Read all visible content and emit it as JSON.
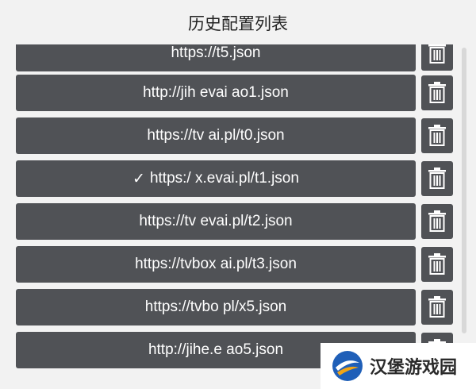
{
  "dialog": {
    "title": "历史配置列表"
  },
  "colors": {
    "button_bg": "#505256",
    "dialog_bg": "#f2f2f2",
    "text": "#ffffff"
  },
  "items": [
    {
      "url": "https://t5.json",
      "selected": false,
      "delete_icon": "trash-icon"
    },
    {
      "url": "http://jih evai ao1.json",
      "selected": false,
      "delete_icon": "trash-icon"
    },
    {
      "url": "https://tv ai.pl/t0.json",
      "selected": false,
      "delete_icon": "trash-icon"
    },
    {
      "url": "https:/ x.evai.pl/t1.json",
      "selected": true,
      "check_mark": "✓",
      "delete_icon": "trash-icon"
    },
    {
      "url": "https://tv evai.pl/t2.json",
      "selected": false,
      "delete_icon": "trash-icon"
    },
    {
      "url": "https://tvbox ai.pl/t3.json",
      "selected": false,
      "delete_icon": "trash-icon"
    },
    {
      "url": "https://tvbo pl/x5.json",
      "selected": false,
      "delete_icon": "trash-icon"
    },
    {
      "url": "http://jihe.e ao5.json",
      "selected": false,
      "delete_icon": "trash-icon"
    }
  ],
  "watermark": {
    "text": "汉堡游戏园",
    "icon": "hanbao-logo-icon"
  }
}
